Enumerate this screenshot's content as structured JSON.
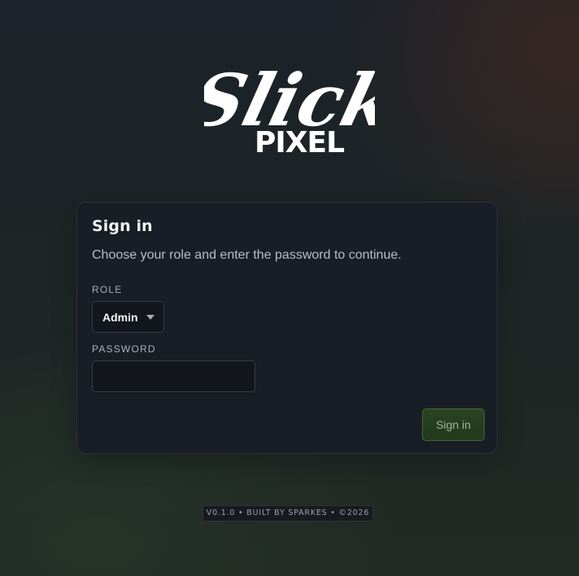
{
  "brand": {
    "logo_script": "Slick",
    "logo_word": "PIXEL"
  },
  "signin": {
    "title": "Sign in",
    "subtitle": "Choose your role and enter the password to continue.",
    "role_label": "ROLE",
    "role_value": "Admin",
    "password_label": "PASSWORD",
    "password_value": "",
    "button_label": "Sign in"
  },
  "footer": {
    "text": "V0.1.0 • BUILT BY SPARKES • ©2026"
  },
  "colors": {
    "accent_green": "#2a4322",
    "card_background": "#191d25"
  },
  "icons": {
    "role_dropdown": "caret-down-icon"
  }
}
